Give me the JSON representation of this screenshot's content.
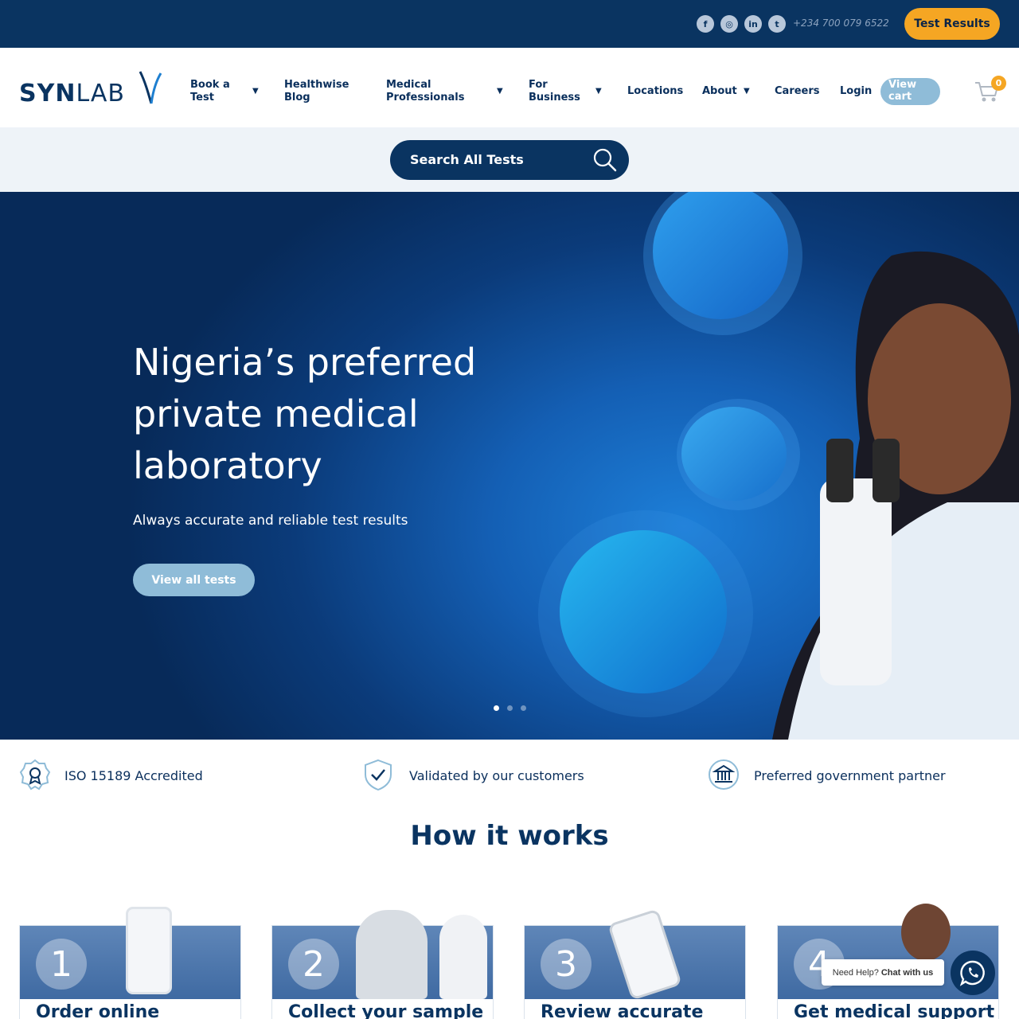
{
  "topbar": {
    "socials": [
      {
        "name": "facebook-icon",
        "glyph": "f"
      },
      {
        "name": "instagram-icon",
        "glyph": "◎"
      },
      {
        "name": "linkedin-icon",
        "glyph": "in"
      },
      {
        "name": "twitter-icon",
        "glyph": "t"
      }
    ],
    "phone": "+234 700 079 6522",
    "test_results_label": "Test Results"
  },
  "brand": {
    "logo_bold": "SYN",
    "logo_light": "LAB"
  },
  "nav": {
    "book_a_test": "Book a Test",
    "healthwise_blog": "Healthwise Blog",
    "medical_professionals": "Medical Professionals",
    "for_business": "For Business",
    "locations": "Locations",
    "about": "About",
    "careers": "Careers",
    "login": "Login",
    "view_cart": "View cart",
    "cart_count": "0"
  },
  "search": {
    "label": "Search All Tests"
  },
  "hero": {
    "headline": "Nigeria’s preferred private medical laboratory",
    "subtitle": "Always accurate and reliable test results",
    "button_label": "View all tests",
    "slides": 3,
    "active_slide": 1
  },
  "badges": [
    {
      "icon": "award-ribbon-icon",
      "label": "ISO 15189 Accredited"
    },
    {
      "icon": "shield-check-icon",
      "label": "Validated by our customers"
    },
    {
      "icon": "government-building-icon",
      "label": "Preferred government partner"
    }
  ],
  "how_it_works": {
    "title": "How it works",
    "steps": [
      {
        "number": "1",
        "title": "Order online"
      },
      {
        "number": "2",
        "title": "Collect your sample"
      },
      {
        "number": "3",
        "title": "Review accurate"
      },
      {
        "number": "4",
        "title": "Get medical support"
      }
    ]
  },
  "chat": {
    "prompt": "Need Help?",
    "action": "Chat with us"
  },
  "colors": {
    "navy": "#0a3461",
    "accent_orange": "#f5a623",
    "light_blue": "#8fbcd8"
  }
}
